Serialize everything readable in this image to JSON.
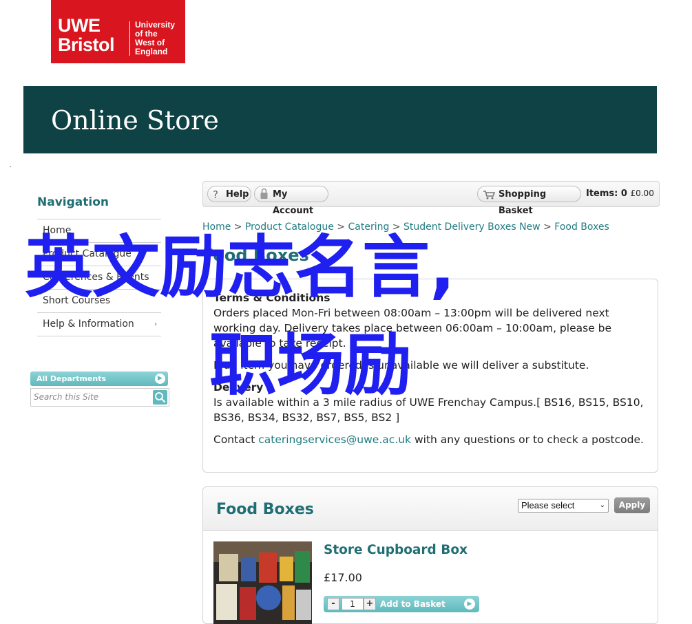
{
  "logo": {
    "line1": "UWE",
    "line2": "Bristol",
    "univ1": "University",
    "univ2": "of the",
    "univ3": "West of",
    "univ4": "England",
    "color": "#d9161f"
  },
  "banner": {
    "title": "Online Store",
    "color": "#0e4245"
  },
  "nav": {
    "heading": "Navigation",
    "items": [
      {
        "label": "Home"
      },
      {
        "label": "Product Catalogue"
      },
      {
        "label": "Conferences & Events"
      },
      {
        "label": "Short Courses"
      },
      {
        "label": "Help & Information",
        "chevron": "›"
      }
    ]
  },
  "departments": {
    "label": "All Departments",
    "search_placeholder": "Search this Site"
  },
  "toolbar": {
    "help": "Help",
    "help_icon": "?",
    "account": "My Account",
    "basket": "Shopping Basket",
    "items_label": "Items:",
    "items_count": "0",
    "items_total": "£0.00"
  },
  "breadcrumb": {
    "items": [
      "Home",
      "Product Catalogue",
      "Catering",
      "Student Delivery Boxes New",
      "Food Boxes"
    ],
    "separator": ">"
  },
  "page_title": "Food Boxes",
  "info": {
    "terms_heading": "Terms & Conditions",
    "terms_text": "Orders placed Mon-Fri between 08:00am – 13:00pm will be delivered next working day. Delivery takes place between 06:00am – 10:00am, please be available to take receipt.",
    "substitute_text": "If an item you have ordered is unavailable we will deliver a substitute.",
    "delivery_heading": "Delivery",
    "delivery_text": "Is available within a 3 mile radius of UWE Frenchay Campus.[ BS16, BS15, BS10, BS36, BS34, BS32, BS7, BS5, BS2 ]",
    "contact_prefix": "Contact ",
    "contact_email": "cateringservices@uwe.ac.uk",
    "contact_suffix": " with any questions or to check a postcode."
  },
  "food_boxes": {
    "title": "Food Boxes",
    "select_value": "Please select",
    "apply": "Apply",
    "product": {
      "name": "Store Cupboard Box",
      "price": "£17.00",
      "quantity": "1",
      "add_label": "Add to Basket",
      "minus": "-",
      "plus": "+"
    }
  },
  "overlay": {
    "line1": "英文励志名言,",
    "line2": "职场励",
    "color": "#1f1ff0"
  },
  "colors": {
    "accent": "#1f6e73",
    "link": "#1f7b80",
    "teal_button": "#5fb9bd"
  }
}
